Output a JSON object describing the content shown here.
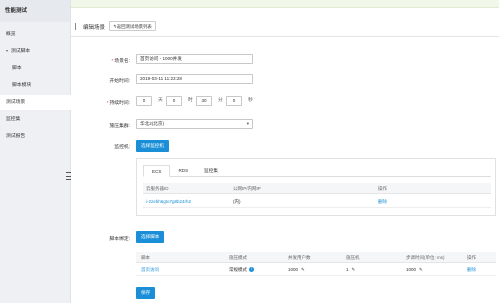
{
  "sidebar": {
    "brand": "性能测试",
    "items": [
      {
        "label": "概览",
        "level": "top"
      },
      {
        "label": "测试脚本",
        "level": "top",
        "caret": "▾"
      },
      {
        "label": "脚本",
        "level": "sub"
      },
      {
        "label": "脚本模块",
        "level": "sub"
      },
      {
        "label": "测试场景",
        "level": "top",
        "active": true
      },
      {
        "label": "监控集",
        "level": "top"
      },
      {
        "label": "测试报告",
        "level": "top"
      }
    ]
  },
  "header": {
    "title": "编辑场景",
    "back_label": "↰返回测试场景列表"
  },
  "form": {
    "scene_name_label": "场景名:",
    "scene_name_value": "首页访问 - 1000并发",
    "start_time_label": "开始时间:",
    "start_time_value": "2019-03-11 11:23:28",
    "duration_label": "持续时间:",
    "duration": {
      "days": "0",
      "days_unit": "天",
      "hours": "0",
      "hours_unit": "时",
      "minutes": "30",
      "minutes_unit": "分",
      "seconds": "0",
      "seconds_unit": "秒"
    },
    "cluster_label": "施压集群:",
    "cluster_value": "华北2(北京)",
    "monitor_label": "监控机:",
    "select_monitor_button": "选择监控机",
    "script_label": "脚本绑定:",
    "select_script_button": "选择脚本",
    "save_button": "保存"
  },
  "monitor_panel": {
    "tabs": [
      "ECS",
      "RDS",
      "监控集"
    ],
    "active_tab": 0,
    "columns": [
      "云服务器ID",
      "公网IP/内网IP",
      "操作"
    ],
    "rows": [
      {
        "id": "i-2zebh6gto7g8b24rh2",
        "ip": "(内)",
        "action": "删除"
      }
    ]
  },
  "script_table": {
    "columns": [
      "脚本",
      "施压模式",
      "并发用户数",
      "施压机",
      "步调时间(单位: ms)",
      "操作"
    ],
    "rows": [
      {
        "script": "首页访问",
        "mode": "常规模式",
        "users": "1000",
        "machines": "1",
        "pacing": "1000",
        "action": "删除"
      }
    ]
  },
  "colors": {
    "accent": "#1a8fd7",
    "required": "#e4393c",
    "sidebar_bg": "#eef0f3"
  }
}
